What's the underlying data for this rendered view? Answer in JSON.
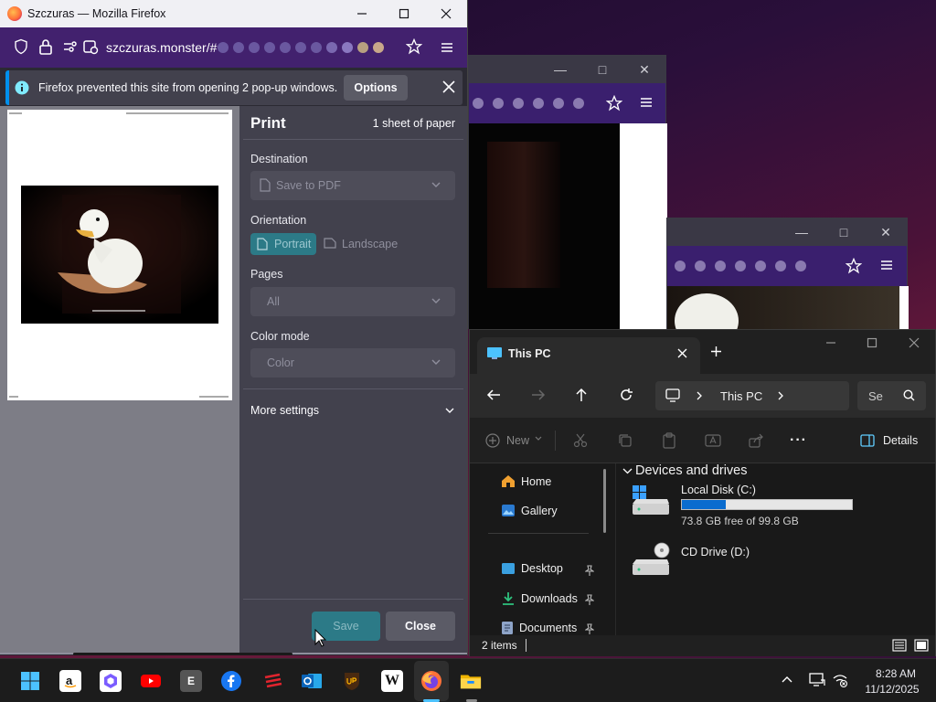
{
  "firefox": {
    "window_title": "Szczuras — Mozilla Firefox",
    "url": "szczuras.monster/#",
    "notification": {
      "message": "Firefox prevented this site from opening 2 pop-up windows.",
      "options_label": "Options"
    },
    "print": {
      "title": "Print",
      "sheets": "1 sheet of paper",
      "destination_label": "Destination",
      "destination_value": "Save to PDF",
      "orientation_label": "Orientation",
      "portrait_label": "Portrait",
      "landscape_label": "Landscape",
      "pages_label": "Pages",
      "pages_value": "All",
      "color_mode_label": "Color mode",
      "color_mode_value": "Color",
      "more_settings_label": "More settings",
      "save_label": "Save",
      "close_label": "Close"
    }
  },
  "explorer": {
    "tab_title": "This PC",
    "breadcrumb": "This PC",
    "search_placeholder": "Se",
    "toolbar": {
      "new_label": "New",
      "more_label": "···",
      "details_label": "Details"
    },
    "sidebar": {
      "items": [
        {
          "label": "Home",
          "pinned": false
        },
        {
          "label": "Gallery",
          "pinned": false
        },
        {
          "label": "Desktop",
          "pinned": true
        },
        {
          "label": "Downloads",
          "pinned": true
        },
        {
          "label": "Documents",
          "pinned": true
        }
      ]
    },
    "section_title": "Devices and drives",
    "drives": [
      {
        "name": "Local Disk (C:)",
        "free_text": "73.8 GB free of 99.8 GB",
        "used_fraction": 0.26
      },
      {
        "name": "CD Drive (D:)"
      }
    ],
    "status": {
      "items_count": "2 items"
    }
  },
  "taskbar": {
    "time": "8:28 AM",
    "date": "11/12/2025",
    "apps": [
      "start",
      "amazon",
      "copilot",
      "youtube",
      "epic",
      "facebook",
      "ticketing",
      "outlook",
      "ups",
      "wikipedia",
      "firefox",
      "file-explorer"
    ],
    "app_letters": {
      "epic": "E",
      "wikipedia": "W"
    }
  },
  "colors": {
    "firefox_nav": "#42216e",
    "accent_teal": "#2c7a87",
    "drive_bar": "#0a6ccf"
  }
}
